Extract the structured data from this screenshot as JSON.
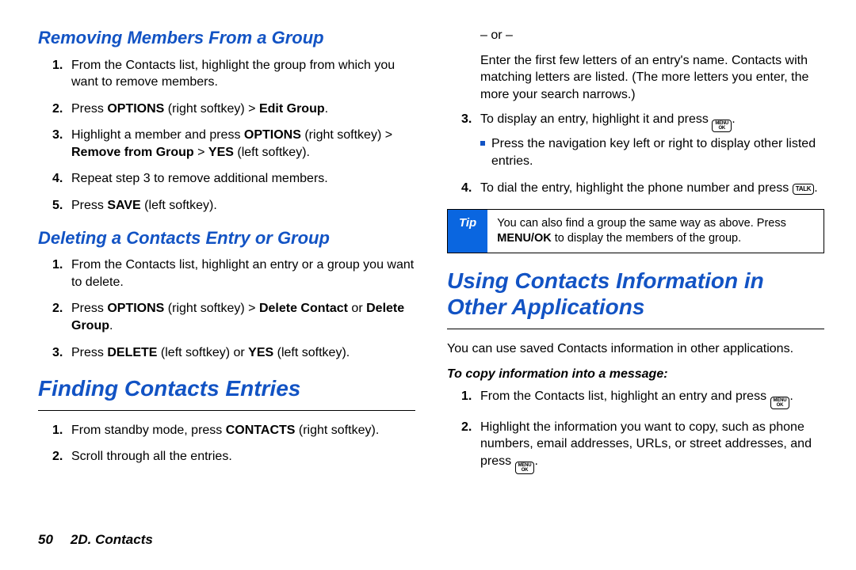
{
  "left": {
    "h_removing": "Removing Members From a Group",
    "removing": {
      "s1": "From the Contacts list, highlight the group from which you want to remove members.",
      "s2_pre": "Press ",
      "s2_b1": "OPTIONS",
      "s2_mid": " (right softkey) > ",
      "s2_b2": "Edit Group",
      "s2_post": ".",
      "s3_pre": "Highlight a member and press ",
      "s3_b1": "OPTIONS",
      "s3_mid": " (right softkey) > ",
      "s3_b2": "Remove from Group",
      "s3_mid2": " > ",
      "s3_b3": "YES",
      "s3_post": " (left softkey).",
      "s4": "Repeat step 3 to remove additional members.",
      "s5_pre": "Press ",
      "s5_b1": "SAVE",
      "s5_post": " (left softkey)."
    },
    "h_deleting": "Deleting a Contacts Entry or Group",
    "deleting": {
      "s1": "From the Contacts list, highlight an entry or a group you want to delete.",
      "s2_pre": "Press ",
      "s2_b1": "OPTIONS",
      "s2_mid": " (right softkey) > ",
      "s2_b2": "Delete Contact",
      "s2_mid2": " or ",
      "s2_b3": "Delete Group",
      "s2_post": ".",
      "s3_pre": "Press ",
      "s3_b1": "DELETE",
      "s3_mid": " (left softkey) or ",
      "s3_b2": "YES",
      "s3_post": " (left softkey)."
    },
    "h_finding": "Finding Contacts Entries",
    "finding": {
      "s1_pre": "From standby mode, press ",
      "s1_b1": "CONTACTS",
      "s1_post": " (right softkey).",
      "s2": "Scroll through all the entries."
    }
  },
  "right": {
    "or_marker": "– or –",
    "or_text": "Enter the first few letters of an entry's name. Contacts with matching letters are listed. (The more letters you enter, the more your search narrows.)",
    "s3_pre": "To display an entry, highlight it and press ",
    "s3_post": ".",
    "s3_sub": "Press the navigation key left or right to display other listed entries.",
    "s4_pre": "To dial the entry, highlight the phone number and press ",
    "s4_post": ".",
    "tip_label": "Tip",
    "tip_body_pre": "You can also find a group the same way as above. Press ",
    "tip_body_b": "MENU/OK",
    "tip_body_post": " to display the members of the group.",
    "h_using": "Using Contacts Information in Other Applications",
    "using_intro": "You can use saved Contacts information in other applications.",
    "copy_heading": "To copy information into a message:",
    "copy": {
      "s1_pre": "From the Contacts list, highlight an entry and press ",
      "s1_post": ".",
      "s2_pre": "Highlight the information you want to copy, such as phone numbers, email addresses, URLs, or street addresses, and press ",
      "s2_post": "."
    }
  },
  "keys": {
    "menu_top": "MENU",
    "menu_bot": "OK",
    "talk": "TALK"
  },
  "footer": {
    "page": "50",
    "section": "2D. Contacts"
  }
}
